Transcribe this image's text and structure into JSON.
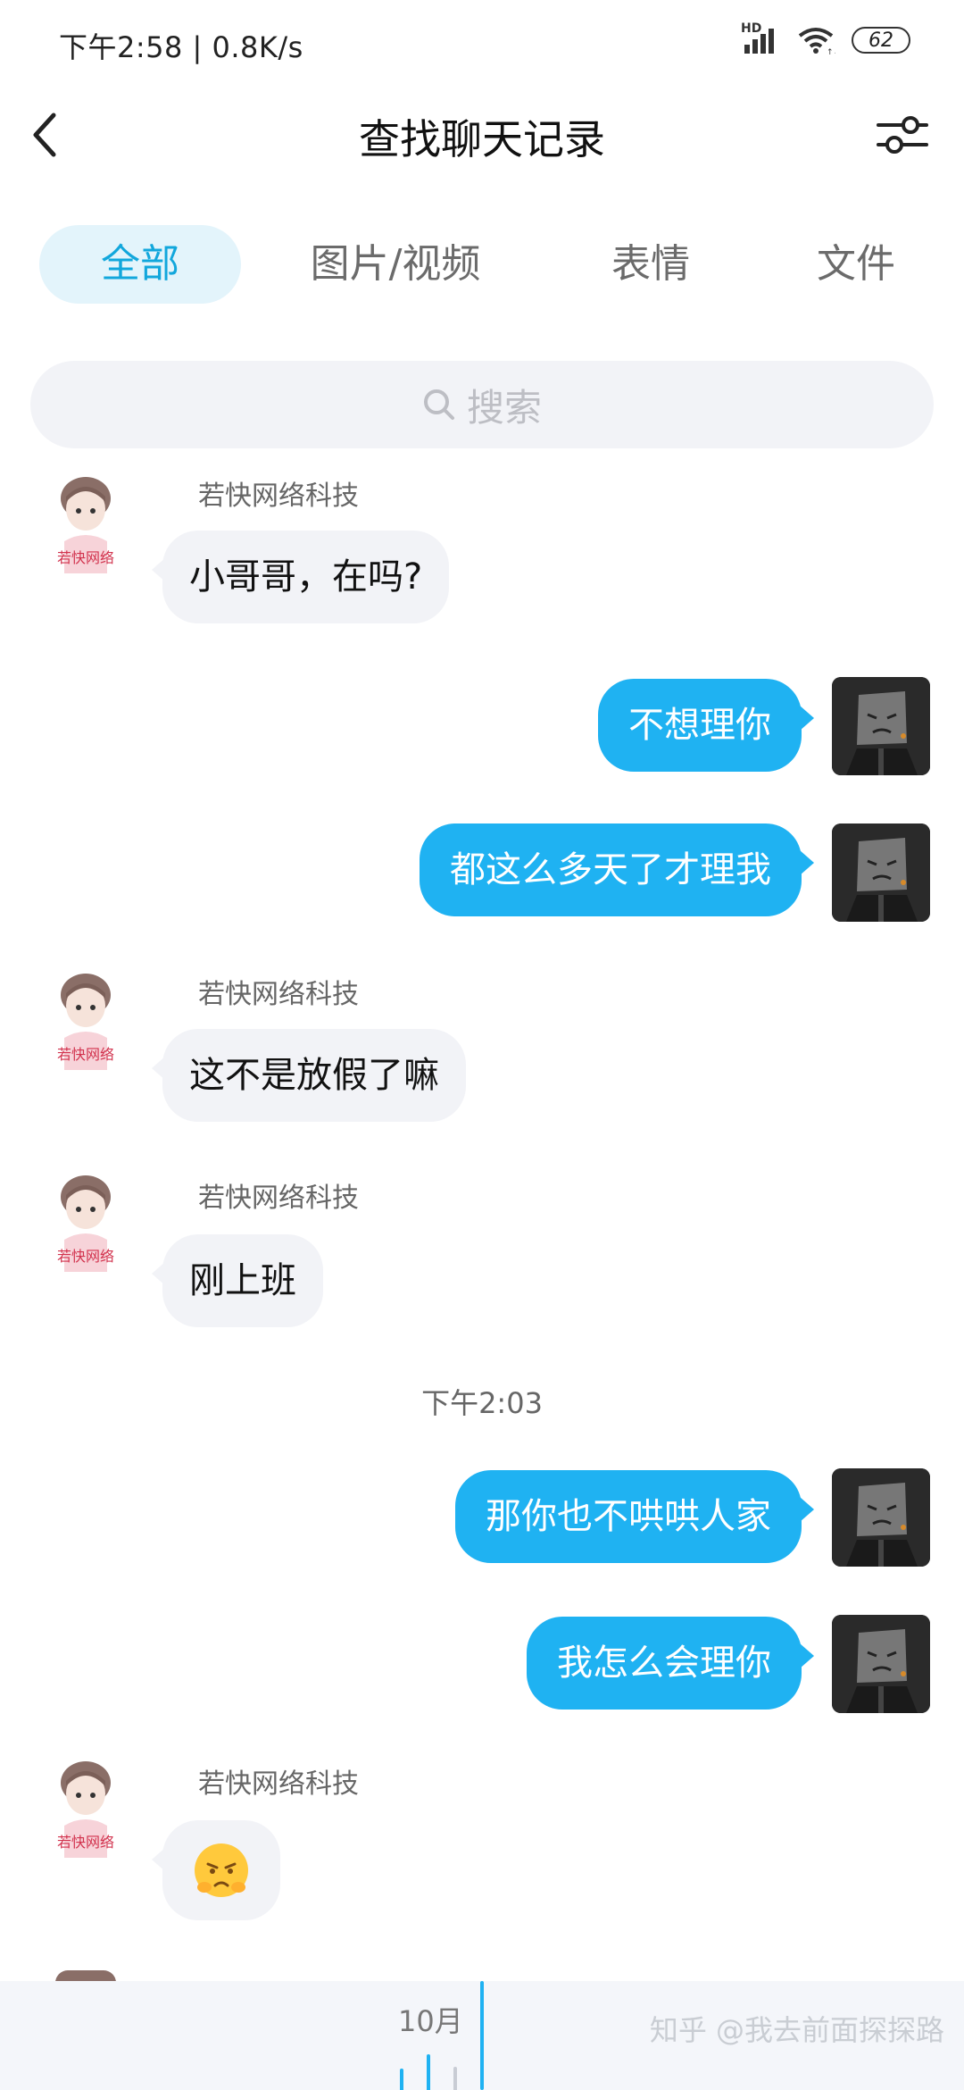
{
  "status_bar": {
    "time_speed": "下午2:58 | 0.8K/s",
    "network_label": "HD",
    "battery": "62"
  },
  "header": {
    "title": "查找聊天记录"
  },
  "tabs": [
    {
      "label": "全部",
      "active": true
    },
    {
      "label": "图片/视频",
      "active": false
    },
    {
      "label": "表情",
      "active": false
    },
    {
      "label": "文件",
      "active": false
    }
  ],
  "search": {
    "placeholder": "搜索"
  },
  "contact": {
    "name": "若快网络科技",
    "avatar_caption": "若快网络"
  },
  "messages": [
    {
      "side": "left",
      "sender": "若快网络科技",
      "text": "小哥哥，在吗?"
    },
    {
      "side": "right",
      "text": "不想理你"
    },
    {
      "side": "right",
      "text": "都这么多天了才理我"
    },
    {
      "side": "left",
      "sender": "若快网络科技",
      "text": "这不是放假了嘛"
    },
    {
      "side": "left",
      "sender": "若快网络科技",
      "text": "刚上班"
    },
    {
      "type": "time",
      "text": "下午2:03"
    },
    {
      "side": "right",
      "text": "那你也不哄哄人家"
    },
    {
      "side": "right",
      "text": "我怎么会理你"
    },
    {
      "side": "left",
      "sender": "若快网络科技",
      "text": "",
      "emoji": "pouting-face"
    }
  ],
  "timeline": {
    "month": "10月"
  },
  "watermark": "知乎 @我去前面探探路",
  "colors": {
    "accent": "#1fb2f2",
    "tab_active_bg": "#e3f4fb",
    "tab_active_text": "#12a7dc",
    "bubble_left": "#f2f3f7"
  }
}
